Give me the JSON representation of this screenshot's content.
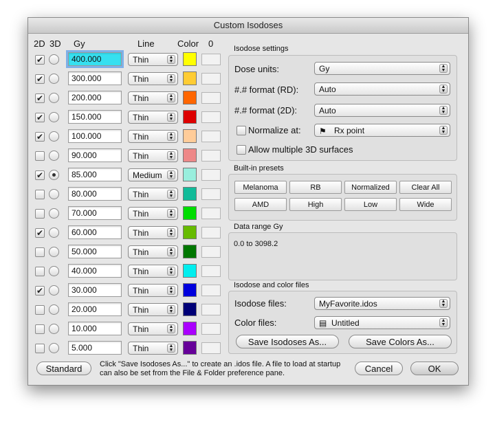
{
  "window": {
    "title": "Custom Isodoses"
  },
  "columns": {
    "c2d": "2D",
    "c3d": "3D",
    "gy": "Gy",
    "line": "Line",
    "color": "Color",
    "zero": "0"
  },
  "rows": [
    {
      "on2d": true,
      "on3d": false,
      "dose": "400.000",
      "line": "Thin",
      "color": "#ffff00"
    },
    {
      "on2d": true,
      "on3d": false,
      "dose": "300.000",
      "line": "Thin",
      "color": "#ffcc33"
    },
    {
      "on2d": true,
      "on3d": false,
      "dose": "200.000",
      "line": "Thin",
      "color": "#ff6600"
    },
    {
      "on2d": true,
      "on3d": false,
      "dose": "150.000",
      "line": "Thin",
      "color": "#dd0000"
    },
    {
      "on2d": true,
      "on3d": false,
      "dose": "100.000",
      "line": "Thin",
      "color": "#ffcc99"
    },
    {
      "on2d": false,
      "on3d": false,
      "dose": "90.000",
      "line": "Thin",
      "color": "#ee8888"
    },
    {
      "on2d": true,
      "on3d": true,
      "dose": "85.000",
      "line": "Medium",
      "color": "#99eedd"
    },
    {
      "on2d": false,
      "on3d": false,
      "dose": "80.000",
      "line": "Thin",
      "color": "#11bb99"
    },
    {
      "on2d": false,
      "on3d": false,
      "dose": "70.000",
      "line": "Thin",
      "color": "#00dd00"
    },
    {
      "on2d": true,
      "on3d": false,
      "dose": "60.000",
      "line": "Thin",
      "color": "#66bb00"
    },
    {
      "on2d": false,
      "on3d": false,
      "dose": "50.000",
      "line": "Thin",
      "color": "#007700"
    },
    {
      "on2d": false,
      "on3d": false,
      "dose": "40.000",
      "line": "Thin",
      "color": "#00eeee"
    },
    {
      "on2d": true,
      "on3d": false,
      "dose": "30.000",
      "line": "Thin",
      "color": "#0000dd"
    },
    {
      "on2d": false,
      "on3d": false,
      "dose": "20.000",
      "line": "Thin",
      "color": "#000077"
    },
    {
      "on2d": false,
      "on3d": false,
      "dose": "10.000",
      "line": "Thin",
      "color": "#aa00ff"
    },
    {
      "on2d": false,
      "on3d": false,
      "dose": "5.000",
      "line": "Thin",
      "color": "#660099"
    }
  ],
  "settings": {
    "group_label": "Isodose settings",
    "dose_units_label": "Dose units:",
    "dose_units_value": "Gy",
    "format_rd_label": "#.# format (RD):",
    "format_rd_value": "Auto",
    "format_2d_label": "#.# format (2D):",
    "format_2d_value": "Auto",
    "normalize_label": "Normalize at:",
    "normalize_value": "Rx point",
    "allow_multi_label": "Allow multiple 3D surfaces"
  },
  "presets": {
    "group_label": "Built-in presets",
    "buttons": [
      "Melanoma",
      "RB",
      "Normalized",
      "Clear All",
      "AMD",
      "High",
      "Low",
      "Wide"
    ]
  },
  "range": {
    "group_label": "Data range  Gy",
    "value": "0.0 to 3098.2"
  },
  "files": {
    "group_label": "Isodose and color files",
    "isodose_label": "Isodose files:",
    "isodose_value": "MyFavorite.idos",
    "color_label": "Color files:",
    "color_value": "Untitled",
    "save_isodoses": "Save Isodoses As...",
    "save_colors": "Save Colors As..."
  },
  "footer": {
    "standard": "Standard",
    "note": "Click \"Save Isodoses As...\" to create an .idos file. A file to load at startup can also be set from the File & Folder preference pane.",
    "cancel": "Cancel",
    "ok": "OK"
  }
}
